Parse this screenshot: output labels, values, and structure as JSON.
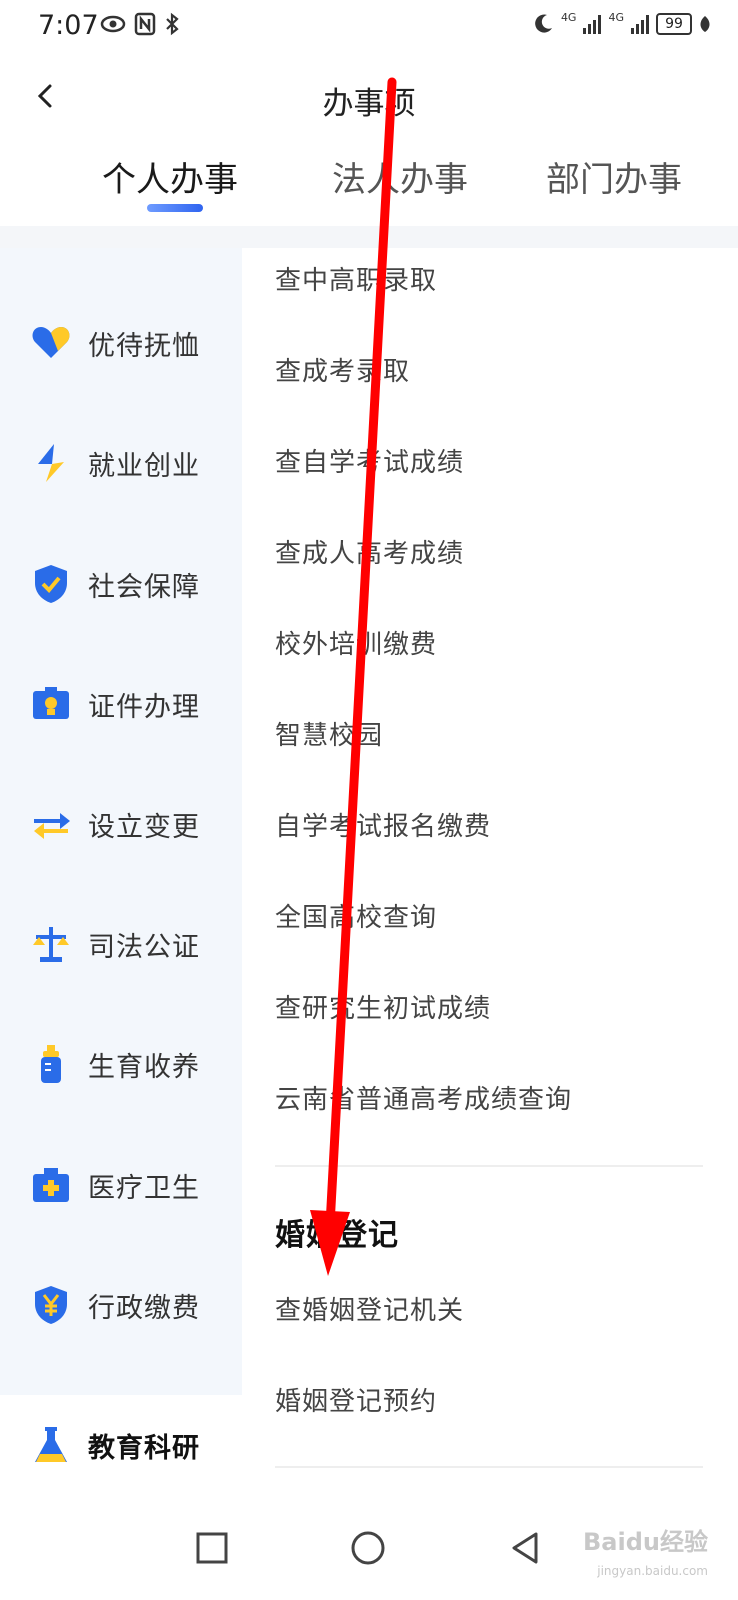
{
  "status": {
    "time": "7:07",
    "net1": "4G",
    "net2": "4G",
    "battery": "99"
  },
  "header": {
    "title": "办事项",
    "tabs": [
      {
        "label": "个人办事",
        "active": true
      },
      {
        "label": "法人办事",
        "active": false
      },
      {
        "label": "部门办事",
        "active": false
      }
    ]
  },
  "sidebar": {
    "items": [
      {
        "label": "优待抚恤",
        "icon": "heart-icon"
      },
      {
        "label": "就业创业",
        "icon": "lightning-icon"
      },
      {
        "label": "社会保障",
        "icon": "shield-check-icon"
      },
      {
        "label": "证件办理",
        "icon": "id-card-icon"
      },
      {
        "label": "设立变更",
        "icon": "swap-arrows-icon"
      },
      {
        "label": "司法公证",
        "icon": "scales-icon"
      },
      {
        "label": "生育收养",
        "icon": "baby-bottle-icon"
      },
      {
        "label": "医疗卫生",
        "icon": "medical-kit-icon"
      },
      {
        "label": "行政缴费",
        "icon": "yuan-coin-icon"
      },
      {
        "label": "教育科研",
        "icon": "flask-icon",
        "active": true
      }
    ]
  },
  "content": {
    "items": [
      "查中高职录取",
      "查成考录取",
      "查自学考试成绩",
      "查成人高考成绩",
      "校外培训缴费",
      "智慧校园",
      "自学考试报名缴费",
      "全国高校查询",
      "查研究生初试成绩",
      "云南省普通高考成绩查询"
    ],
    "section": {
      "title": "婚姻登记",
      "items": [
        "查婚姻登记机关",
        "婚姻登记预约"
      ]
    }
  },
  "watermark": {
    "text": "Baidu经验",
    "sub": "jingyan.baidu.com"
  },
  "colors": {
    "accent": "#2f64f0",
    "icon_blue": "#2a6ce8",
    "icon_yellow": "#ffc928",
    "annotation": "#ff0000"
  }
}
